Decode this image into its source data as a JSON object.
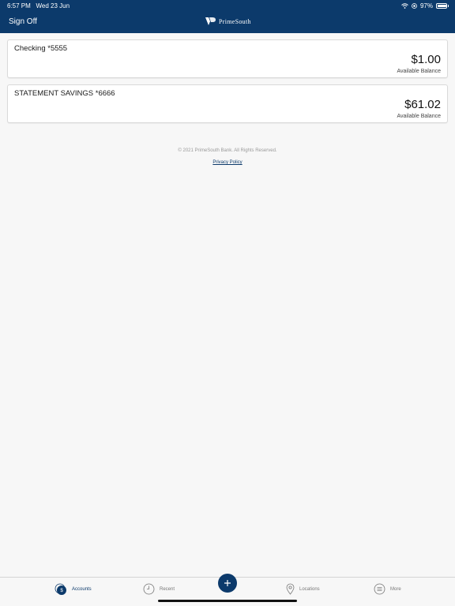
{
  "status_bar": {
    "time": "6:57 PM",
    "date": "Wed 23 Jun",
    "battery": "97%",
    "battery_level": 0.97
  },
  "header": {
    "sign_off_label": "Sign Off",
    "logo_text": "PrimeSouth"
  },
  "accounts": [
    {
      "name": "Checking *5555",
      "balance": "$1.00",
      "balance_label": "Available Balance"
    },
    {
      "name": "STATEMENT SAVINGS *6666",
      "balance": "$61.02",
      "balance_label": "Available Balance"
    }
  ],
  "footer": {
    "copyright": "© 2021 PrimeSouth Bank. All Rights Reserved.",
    "privacy_label": "Privacy Policy"
  },
  "tabbar": {
    "items": [
      {
        "label": "Accounts",
        "icon": "accounts-dollar-icon",
        "active": true
      },
      {
        "label": "Recent",
        "icon": "clock-icon",
        "active": false
      },
      {
        "label": "Locations",
        "icon": "map-pin-icon",
        "active": false
      },
      {
        "label": "More",
        "icon": "menu-lines-icon",
        "active": false
      }
    ],
    "fab_icon": "plus-icon"
  },
  "colors": {
    "brand": "#0c3a6b",
    "background": "#f7f7f7"
  }
}
